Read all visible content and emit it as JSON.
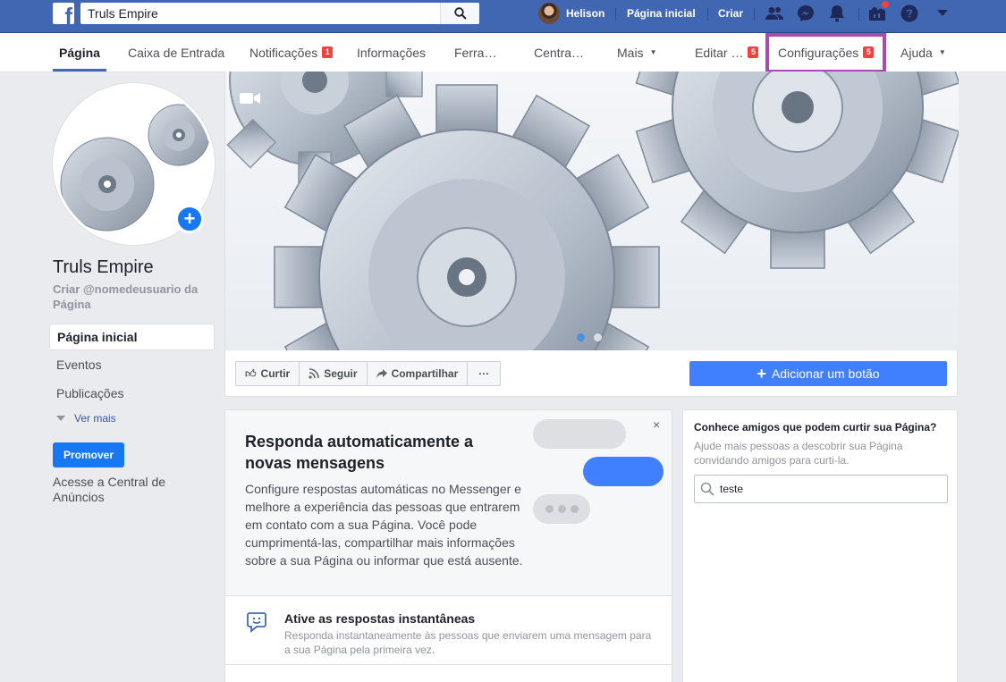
{
  "topbar": {
    "logo_letter": "f",
    "search_value": "Truls Empire",
    "user_name": "Helison",
    "home_label": "Página inicial",
    "create_label": "Criar"
  },
  "pagenav": {
    "items": [
      {
        "label": "Página",
        "active": true
      },
      {
        "label": "Caixa de Entrada"
      },
      {
        "label": "Notificações",
        "badge": "1"
      },
      {
        "label": "Informações"
      },
      {
        "label": "Ferra…"
      },
      {
        "label": "Centra…"
      },
      {
        "label": "Mais"
      },
      {
        "label": "Editar …",
        "badge": "5"
      },
      {
        "label": "Configurações",
        "badge": "5"
      },
      {
        "label": "Ajuda"
      }
    ]
  },
  "left": {
    "page_name": "Truls Empire",
    "username_link": "Criar @nomedeusuario da Página",
    "menu": [
      "Página inicial",
      "Eventos",
      "Publicações"
    ],
    "see_more": "Ver mais",
    "promote": "Promover",
    "ads_link": "Acesse a Central de Anúncios"
  },
  "cover": {
    "actions": [
      "Curtir",
      "Seguir",
      "Compartilhar",
      "···"
    ],
    "add_button": "Adicionar um botão"
  },
  "messenger_card": {
    "title": "Responda automaticamente a novas mensagens",
    "body": "Configure respostas automáticas no Messenger e melhore a experiência das pessoas que entrarem em contato com a sua Página. Você pode cumprimentá-las, compartilhar mais informações sobre a sua Página ou informar que está ausente.",
    "close": "×",
    "instant_title": "Ative as respostas instantâneas",
    "instant_desc": "Responda instantaneamente às pessoas que enviarem uma mensagem para a sua Página pela primeira vez."
  },
  "invite_card": {
    "title": "Conhece amigos que podem curtir sua Página?",
    "desc": "Ajude mais pessoas a descobrir sua Página convidando amigos para curti-la.",
    "search_value": "teste"
  },
  "colors": {
    "brand": "#4267b2",
    "primary_button": "#1877f2",
    "badge": "#fa3e3e",
    "highlight": "#a44dac"
  }
}
